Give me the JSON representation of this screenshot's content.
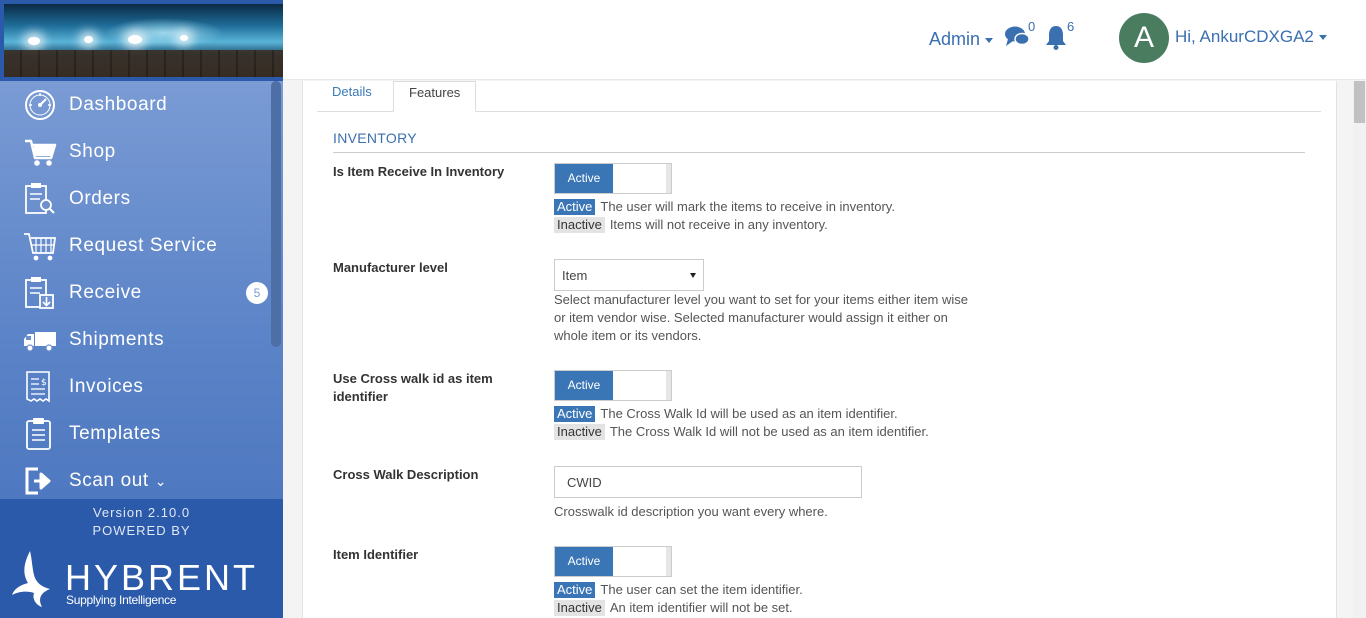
{
  "header": {
    "admin_label": "Admin",
    "chat_count": "0",
    "notification_count": "6",
    "avatar_initial": "A",
    "user_greeting": "Hi, AnkurCDXGA2"
  },
  "sidebar": {
    "items": [
      {
        "label": "Dashboard",
        "icon": "dashboard-icon"
      },
      {
        "label": "Shop",
        "icon": "cart-icon"
      },
      {
        "label": "Orders",
        "icon": "orders-icon"
      },
      {
        "label": "Request Service",
        "icon": "request-service-icon"
      },
      {
        "label": "Receive",
        "icon": "receive-icon",
        "badge": "5"
      },
      {
        "label": "Shipments",
        "icon": "truck-icon"
      },
      {
        "label": "Invoices",
        "icon": "invoice-icon"
      },
      {
        "label": "Templates",
        "icon": "templates-icon"
      },
      {
        "label": "Scan out",
        "icon": "scan-out-icon"
      }
    ],
    "version": "Version 2.10.0",
    "powered_by": "POWERED BY",
    "brand_name": "HYBRENT",
    "brand_tagline": "Supplying Intelligence"
  },
  "tabs": {
    "details": "Details",
    "features": "Features",
    "active_tab": "Features"
  },
  "inventory": {
    "section_title": "INVENTORY",
    "item_receive": {
      "label": "Is Item Receive In Inventory",
      "toggle": "Active",
      "active_tag": "Active",
      "active_text": "The user will mark the items to receive in inventory.",
      "inactive_tag": "Inactive",
      "inactive_text": "Items will not receive in any inventory."
    },
    "manufacturer_level": {
      "label": "Manufacturer level",
      "selected": "Item",
      "help": "Select manufacturer level you want to set for your items either item wise or item vendor wise. Selected manufacturer would assign it either on whole item or its vendors."
    },
    "cross_walk": {
      "label": "Use Cross walk id as item identifier",
      "toggle": "Active",
      "active_tag": "Active",
      "active_text": "The Cross Walk Id will be used as an item identifier.",
      "inactive_tag": "Inactive",
      "inactive_text": "The Cross Walk Id will not be used as an item identifier."
    },
    "cross_walk_description": {
      "label": "Cross Walk Description",
      "value": "CWID",
      "help": "Crosswalk id description you want every where."
    },
    "item_identifier": {
      "label": "Item Identifier",
      "toggle": "Active",
      "active_tag": "Active",
      "active_text": "The user can set the item identifier.",
      "inactive_tag": "Inactive",
      "inactive_text": "An item identifier will not be set."
    }
  },
  "colors": {
    "accent": "#3a76b6",
    "sidebar_footer": "#2b5aaa",
    "avatar": "#4a7c60"
  }
}
